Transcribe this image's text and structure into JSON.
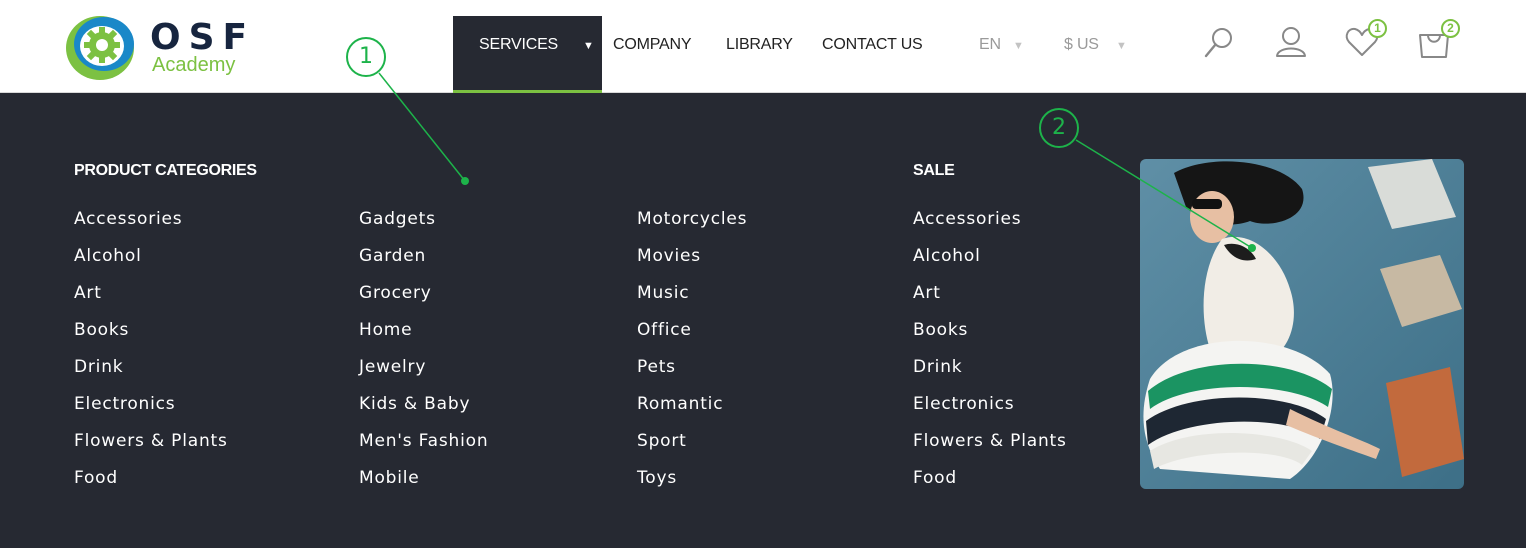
{
  "brand": {
    "name": "OSF",
    "subtitle": "Academy"
  },
  "nav": {
    "items": [
      "SERVICES",
      "COMPANY",
      "LIBRARY",
      "CONTACT US"
    ],
    "caret": "▼",
    "language": "EN",
    "currency": "$ US"
  },
  "icons": {
    "search": "search-icon",
    "account": "user-icon",
    "wishlist": "heart-icon",
    "cart": "cart-icon",
    "wishlist_count": "1",
    "cart_count": "2"
  },
  "mega_menu": {
    "product_categories_title": "PRODUCT CATEGORIES",
    "sale_title": "SALE",
    "columns": [
      [
        "Accessories",
        "Alcohol",
        "Art",
        "Books",
        "Drink",
        "Electronics",
        "Flowers & Plants",
        "Food"
      ],
      [
        "Gadgets",
        "Garden",
        "Grocery",
        "Home",
        "Jewelry",
        "Kids & Baby",
        "Men's Fashion",
        "Mobile"
      ],
      [
        "Motorcycles",
        "Movies",
        "Music",
        "Office",
        "Pets",
        "Romantic",
        "Sport",
        "Toys"
      ],
      [
        "Accessories",
        "Alcohol",
        "Art",
        "Books",
        "Drink",
        "Electronics",
        "Flowers & Plants",
        "Food"
      ]
    ]
  },
  "callouts": [
    "1",
    "2"
  ],
  "colors": {
    "accent": "#7cc142",
    "dark": "#262932",
    "callout": "#1db34a"
  }
}
